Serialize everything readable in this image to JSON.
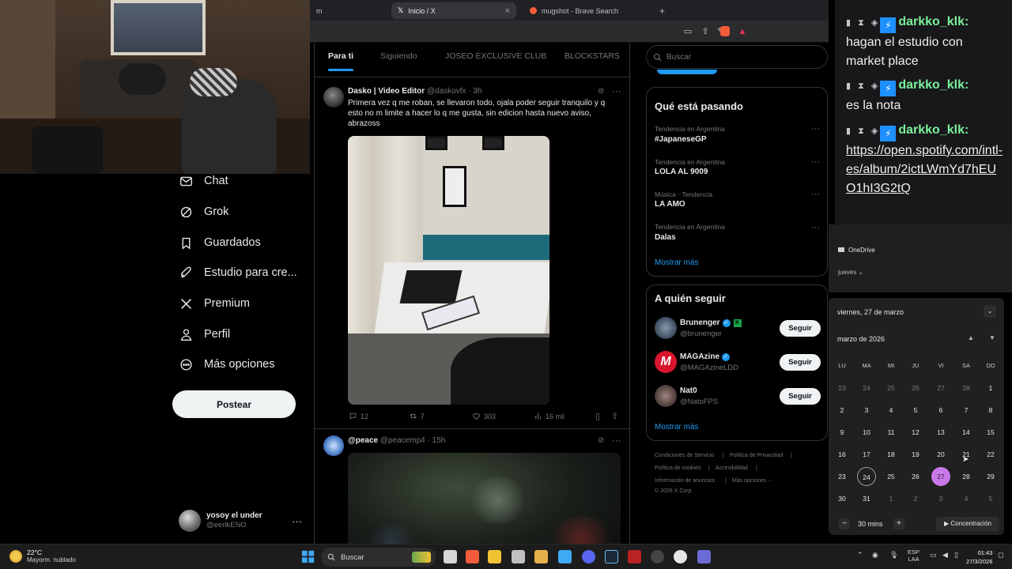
{
  "browser": {
    "tabs": [
      {
        "label": "m",
        "active": false
      },
      {
        "label": "Inicio / X",
        "active": true
      },
      {
        "label": "mugshot - Brave Search",
        "active": false
      }
    ],
    "new_tab": "+"
  },
  "nav": {
    "items": [
      {
        "label": "Chat",
        "icon": "envelope-icon"
      },
      {
        "label": "Grok",
        "icon": "grok-icon"
      },
      {
        "label": "Guardados",
        "icon": "bookmark-icon"
      },
      {
        "label": "Estudio para cre...",
        "icon": "rocket-icon"
      },
      {
        "label": "Premium",
        "icon": "x-logo-icon"
      },
      {
        "label": "Perfil",
        "icon": "person-icon"
      },
      {
        "label": "Más opciones",
        "icon": "more-circle-icon"
      }
    ],
    "post_button": "Postear",
    "account": {
      "name": "yosoy el under",
      "handle": "@eerlkENO",
      "more": "···"
    }
  },
  "feed": {
    "tabs": [
      "Para ti",
      "Siguiendo",
      "JOSEO EXCLUSIVE CLUB",
      "BLOCKSTARS"
    ],
    "tweets": [
      {
        "name": "Dasko | Video Editor",
        "handle": "@daskovfx",
        "time": "· 3h",
        "text": "Primera vez q me roban, se llevaron todo, ojala poder seguir tranquilo y q esto no m limite a hacer lo q me gusta, sin edicion hasta nuevo aviso, abrazoss",
        "replies": "12",
        "reposts": "7",
        "likes": "303",
        "views": "16 mil"
      },
      {
        "name": "@peace",
        "handle": "@peacemp4",
        "time": "· 15h"
      }
    ]
  },
  "sidebar": {
    "search_placeholder": "Buscar",
    "trends_title": "Qué está pasando",
    "trends": [
      {
        "meta": "Tendencia en Argentina",
        "name": "#JapaneseGP"
      },
      {
        "meta": "Tendencia en Argentina",
        "name": "LOLA AL 9009"
      },
      {
        "meta": "Música · Tendencia",
        "name": "LA AMO"
      },
      {
        "meta": "Tendencia en Argentina",
        "name": "Dalas"
      }
    ],
    "show_more": "Mostrar más",
    "follow_title": "A quién seguir",
    "follow": [
      {
        "name": "Brunenger",
        "handle": "@brunenger",
        "button": "Seguir",
        "color": "#3a4a5c"
      },
      {
        "name": "MAGAzine",
        "handle": "@MAGAzineLDD",
        "button": "Seguir",
        "color": "#d8162d"
      },
      {
        "name": "Nat0",
        "handle": "@NatoFPS",
        "button": "Seguir",
        "color": "#5a4a48"
      }
    ],
    "follow_show_more": "Mostrar más",
    "footer": [
      "Condiciones de Servicio",
      "|",
      "Política de Privacidad",
      "|",
      "Política de cookies",
      "|",
      "Accesibilidad",
      "|",
      "Información de anuncios",
      "|",
      "Más opciones ···",
      "© 2026 X Corp."
    ]
  },
  "chat": {
    "messages": [
      {
        "user": "darkko_klk:",
        "text": "hagan el estudio con market place"
      },
      {
        "user": "darkko_klk:",
        "text": "es la nota"
      },
      {
        "user": "darkko_klk:",
        "link": "https://open.spotify.com/intl-es/album/2ictLWmYd7hEUO1hI3G2tQ"
      }
    ]
  },
  "windows_panel": {
    "onedrive": "OneDrive",
    "jueves": "jueves",
    "date_header": "viernes, 27 de marzo",
    "month": "marzo de 2026",
    "dows": [
      "LU",
      "MA",
      "MI",
      "JU",
      "VI",
      "SA",
      "DO"
    ],
    "weeks": [
      [
        "23",
        "24",
        "25",
        "26",
        "27",
        "28",
        "1"
      ],
      [
        "2",
        "3",
        "4",
        "5",
        "6",
        "7",
        "8"
      ],
      [
        "9",
        "10",
        "11",
        "12",
        "13",
        "14",
        "15"
      ],
      [
        "16",
        "17",
        "18",
        "19",
        "20",
        "21",
        "22"
      ],
      [
        "23",
        "24",
        "25",
        "26",
        "27",
        "28",
        "29"
      ],
      [
        "30",
        "31",
        "1",
        "2",
        "3",
        "4",
        "5"
      ]
    ],
    "focus_minutes": "30 mins",
    "focus_button": "Concentración",
    "minus": "−",
    "plus": "+"
  },
  "taskbar": {
    "weather_temp": "22°C",
    "weather_desc": "Mayorm. nublado",
    "search": "Buscar",
    "lang1": "ESP",
    "lang2": "LAA",
    "time": "01:43",
    "date": "27/3/2026"
  }
}
